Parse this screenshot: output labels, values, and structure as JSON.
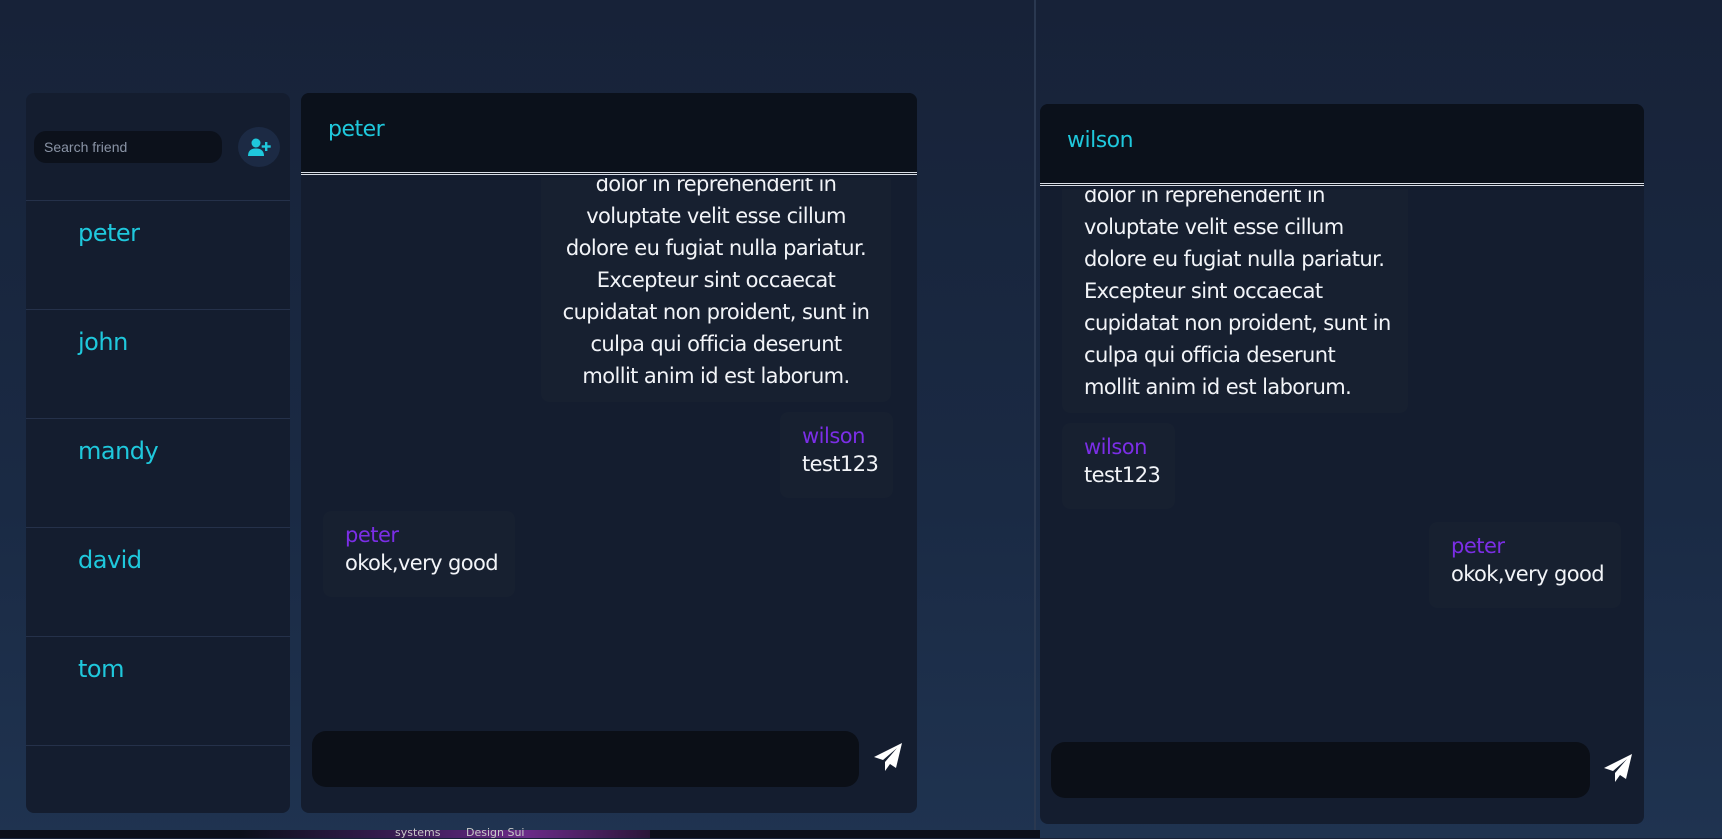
{
  "sidebar": {
    "search_placeholder": "Search friend",
    "add_friend_icon": "user-plus-icon",
    "friends": [
      {
        "name": "peter"
      },
      {
        "name": "john"
      },
      {
        "name": "mandy"
      },
      {
        "name": "david"
      },
      {
        "name": "tom"
      }
    ]
  },
  "chat_left": {
    "title": "peter",
    "long_message": "exercitation ullamco laboris nisi ut aliquip ex ea commodo consequat. Duis aute irure dolor in reprehenderit in voluptate velit esse cillum dolore eu fugiat nulla pariatur. Excepteur sint occaecat cupidatat non proident, sunt in culpa qui officia deserunt mollit anim id est laborum.",
    "messages": [
      {
        "sender": "wilson",
        "text": "test123"
      },
      {
        "sender": "peter",
        "text": "okok,very good"
      }
    ],
    "input_value": "",
    "send_icon": "paper-plane-icon"
  },
  "chat_right": {
    "title": "wilson",
    "long_message": "exercitation ullamco laboris nisi ut aliquip ex ea commodo consequat. Duis aute irure dolor in reprehenderit in voluptate velit esse cillum dolore eu fugiat nulla pariatur. Excepteur sint occaecat cupidatat non proident, sunt in culpa qui officia deserunt mollit anim id est laborum.",
    "messages": [
      {
        "sender": "wilson",
        "text": "test123"
      },
      {
        "sender": "peter",
        "text": "okok,very good"
      }
    ],
    "input_value": "",
    "send_icon": "paper-plane-icon"
  },
  "taskbar": {
    "items": [
      "systems",
      "Design Sui"
    ]
  },
  "colors": {
    "accent_cyan": "#1fc8dc",
    "sender_purple": "#7b2ee6",
    "panel": "#141d2f"
  }
}
